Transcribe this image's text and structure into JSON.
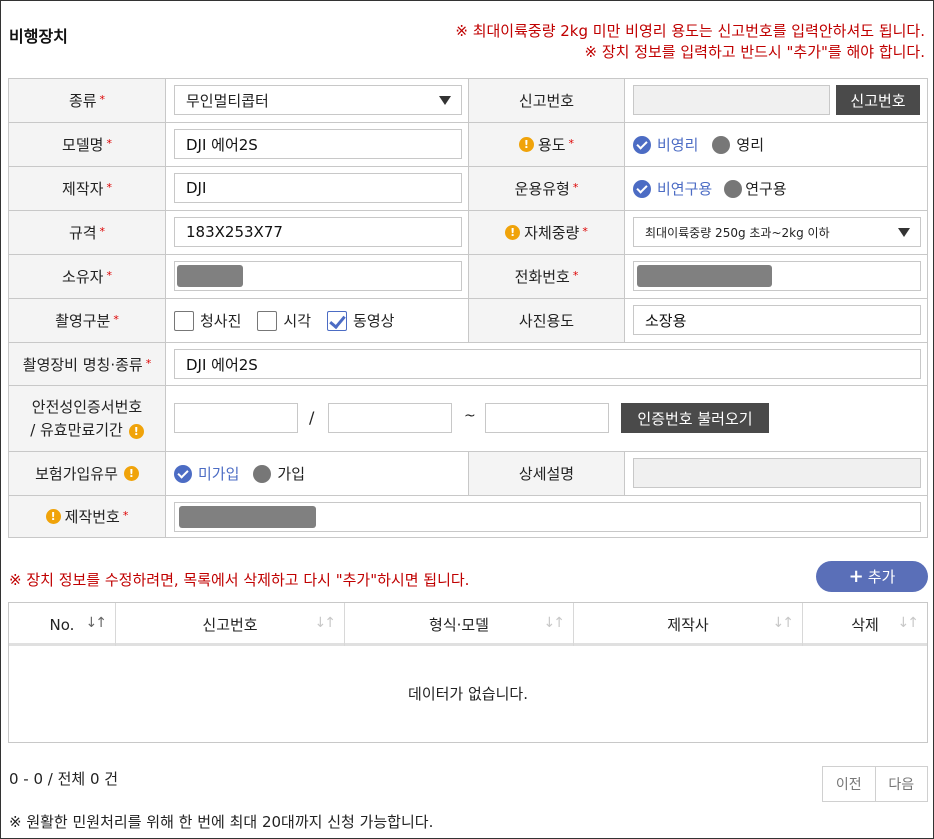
{
  "section_title": "비행장치",
  "notices_top": [
    "※ 최대이륙중량 2kg 미만 비영리 용도는 신고번호를 입력안하셔도 됩니다.",
    "※ 장치 정보를 입력하고 반드시 \"추가\"를 해야 합니다."
  ],
  "form": {
    "type": {
      "label": "종류",
      "value": "무인멀티콥터"
    },
    "report_no": {
      "label": "신고번호",
      "value": "",
      "button": "신고번호"
    },
    "model": {
      "label": "모델명",
      "value": "DJI 에어2S"
    },
    "purpose": {
      "label": "용도",
      "options": [
        "비영리",
        "영리"
      ],
      "selected": "비영리"
    },
    "maker": {
      "label": "제작자",
      "value": "DJI"
    },
    "operation_type": {
      "label": "운용유형",
      "options": [
        "비연구용",
        "연구용"
      ],
      "selected": "비연구용"
    },
    "spec": {
      "label": "규격",
      "value": "183X253X77"
    },
    "self_weight": {
      "label": "자체중량",
      "value": "최대이륙중량 250g 초과~2kg 이하"
    },
    "owner": {
      "label": "소유자"
    },
    "phone": {
      "label": "전화번호"
    },
    "shoot_type": {
      "label": "촬영구분",
      "options": [
        "청사진",
        "시각",
        "동영상"
      ],
      "checked": [
        "동영상"
      ]
    },
    "photo_use": {
      "label": "사진용도",
      "value": "소장용"
    },
    "camera": {
      "label": "촬영장비 명칭·종류",
      "value": "DJI 에어2S"
    },
    "cert": {
      "label_line1": "안전성인증서번호",
      "label_line2": "/ 유효만료기간",
      "sep1": "/",
      "sep2": "~",
      "button": "인증번호 불러오기"
    },
    "insurance": {
      "label": "보험가입유무",
      "options": [
        "미가입",
        "가입"
      ],
      "selected": "미가입"
    },
    "detail": {
      "label": "상세설명",
      "value": ""
    },
    "serial": {
      "label": "제작번호"
    }
  },
  "required_mark": "*",
  "warn_icon": "!",
  "notice_mid": "※ 장치 정보를 수정하려면, 목록에서 삭제하고 다시 \"추가\"하시면 됩니다.",
  "add_button": {
    "icon": "+",
    "label": "추가"
  },
  "table": {
    "columns": [
      "No.",
      "신고번호",
      "형식·모델",
      "제작사",
      "삭제"
    ],
    "sort_icon": "↓↑",
    "empty_text": "데이터가 없습니다."
  },
  "pagination": {
    "count_text": "0 - 0 / 전체 0 건",
    "prev": "이전",
    "next": "다음"
  },
  "footnote": "※ 원활한 민원처리를 위해 한 번에 최대 20대까지 신청 가능합니다.",
  "colors": {
    "accent": "#4c6cc4",
    "notice": "#c00000",
    "warn": "#f0a30a",
    "dark_button": "#4a4a4a",
    "add_button": "#5a6fb8"
  }
}
